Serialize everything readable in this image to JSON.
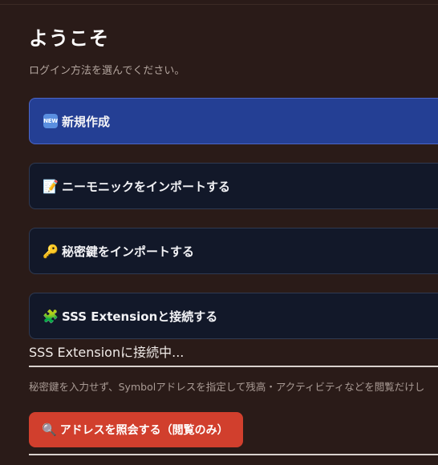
{
  "header": {
    "title": "ようこそ",
    "subtitle": "ログイン方法を選んでください。"
  },
  "options": [
    {
      "icon": "new-badge-icon",
      "badge_text": "NEW",
      "label": "新規作成",
      "primary": true
    },
    {
      "icon": "memo-icon",
      "glyph": "📝",
      "label": "ニーモニックをインポートする"
    },
    {
      "icon": "key-icon",
      "glyph": "🔑",
      "label": "秘密鍵をインポートする"
    },
    {
      "icon": "puzzle-icon",
      "glyph": "🧩",
      "label": "SSS Extensionと接続する"
    }
  ],
  "status": "SSS Extensionに接続中...",
  "note": "秘密鍵を入力せず、Symbolアドレスを指定して残高・アクティビティなどを閲覧だけし",
  "view_button": {
    "icon": "magnifier-icon",
    "glyph": "🔍",
    "label": "アドレスを照会する（閲覧のみ）"
  },
  "colors": {
    "background": "#2a1b18",
    "primary": "#243f94",
    "option": "#121829",
    "danger": "#d13f2d"
  }
}
